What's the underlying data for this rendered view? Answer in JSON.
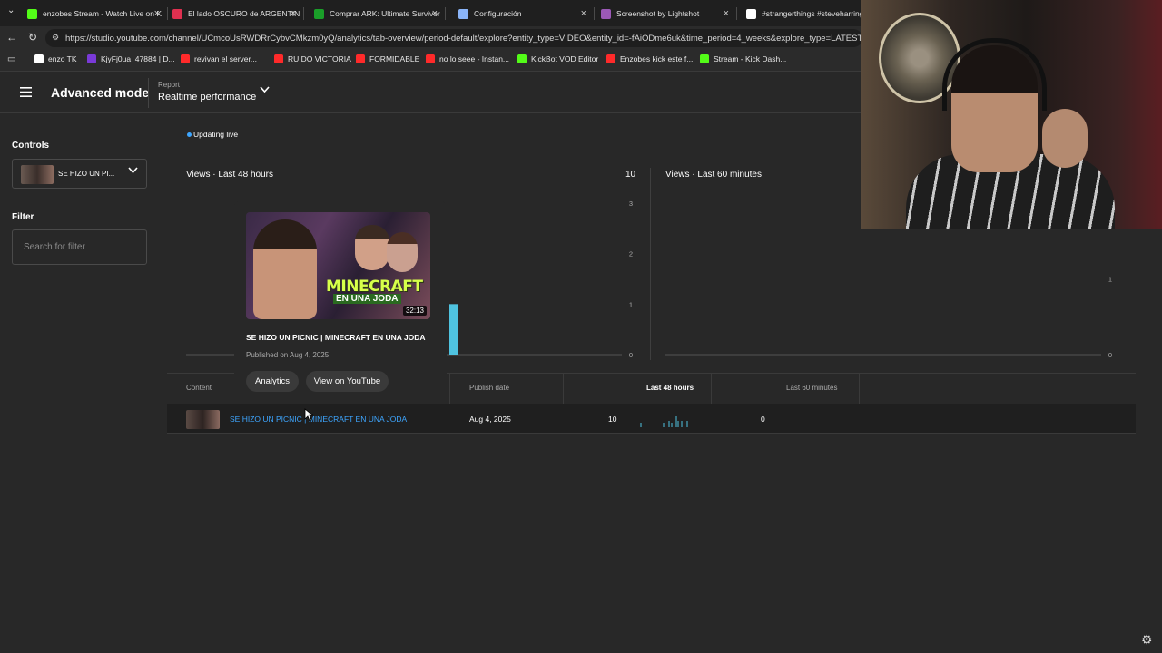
{
  "browser": {
    "tabs": [
      {
        "label": "enzobes Stream - Watch Live on K",
        "favicon_color": "#53fc18"
      },
      {
        "label": "El lado OSCURO de ARGENTINA #",
        "favicon_color": "#e03050"
      },
      {
        "label": "Comprar ARK: Ultimate Survivor E",
        "favicon_color": "#1a9f29"
      },
      {
        "label": "Configuración",
        "favicon_color": "#8ab4f8"
      },
      {
        "label": "Screenshot by Lightshot",
        "favicon_color": "#9b59b6"
      },
      {
        "label": "#strangerthings #steveharringt",
        "favicon_color": "#ffffff"
      }
    ],
    "url": "https://studio.youtube.com/channel/UCmcoUsRWDRrCybvCMkzm0yQ/analytics/tab-overview/period-default/explore?entity_type=VIDEO&entity_id=-fAiODme6uk&time_period=4_weeks&explore_type=LATEST_AC",
    "bookmarks": [
      {
        "label": "enzo TK",
        "color": "#ffffff"
      },
      {
        "label": "KjyFj0ua_47884 | D...",
        "color": "#7a3ad8"
      },
      {
        "label": "revivan el server...",
        "color": "#ff2a2a"
      },
      {
        "label": "RUIDO VICTORIA",
        "color": "#ff2a2a"
      },
      {
        "label": "FORMIDABLE",
        "color": "#ff2a2a"
      },
      {
        "label": "no lo seee - Instan...",
        "color": "#ff2a2a"
      },
      {
        "label": "KickBot VOD Editor",
        "color": "#53fc18"
      },
      {
        "label": "Enzobes kick este f...",
        "color": "#ff2a2a"
      },
      {
        "label": "Stream - Kick Dash...",
        "color": "#53fc18"
      }
    ]
  },
  "header": {
    "title": "Advanced mode",
    "report_label": "Report",
    "report_value": "Realtime performance"
  },
  "sidebar": {
    "controls_label": "Controls",
    "selected_video": "SE HIZO UN PI...",
    "filter_label": "Filter",
    "filter_placeholder": "Search for filter"
  },
  "main": {
    "live_status": "Updating live",
    "views48_title": "Views · Last 48 hours",
    "views48_total": "10",
    "views60_title": "Views · Last 60 minutes"
  },
  "hover_card": {
    "thumb_text1": "MINECRAFT",
    "thumb_text2": "EN UNA JODA",
    "duration": "32:13",
    "title": "SE HIZO UN PICNIC | MINECRAFT EN UNA JODA",
    "published": "Published on Aug 4, 2025",
    "analytics_button": "Analytics",
    "youtube_button": "View on YouTube"
  },
  "table": {
    "headers": {
      "content": "Content",
      "publish_date": "Publish date",
      "last48": "Last 48 hours",
      "last60": "Last 60 minutes"
    },
    "rows": [
      {
        "title": "SE HIZO UN PICNIC | MINECRAFT EN UNA JODA",
        "publish_date": "Aug 4, 2025",
        "last48": "10",
        "last60": "0"
      }
    ]
  },
  "colors": {
    "accent": "#3ea6ff",
    "bar": "#4fc3e0",
    "background": "#282828"
  },
  "chart_data": [
    {
      "type": "bar",
      "title": "Views · Last 48 hours",
      "x": [
        16,
        18,
        19,
        21,
        22,
        25,
        29
      ],
      "values": [
        1,
        1,
        1,
        2,
        1,
        1,
        1
      ],
      "xlim": [
        0,
        48
      ],
      "ylim": [
        0,
        3
      ],
      "yticks": [
        0,
        1,
        2,
        3
      ],
      "total": 10
    },
    {
      "type": "bar",
      "title": "Views · Last 60 minutes",
      "x": [],
      "values": [],
      "ylim": [
        0,
        2
      ],
      "yticks": [
        0,
        1,
        2
      ]
    }
  ]
}
